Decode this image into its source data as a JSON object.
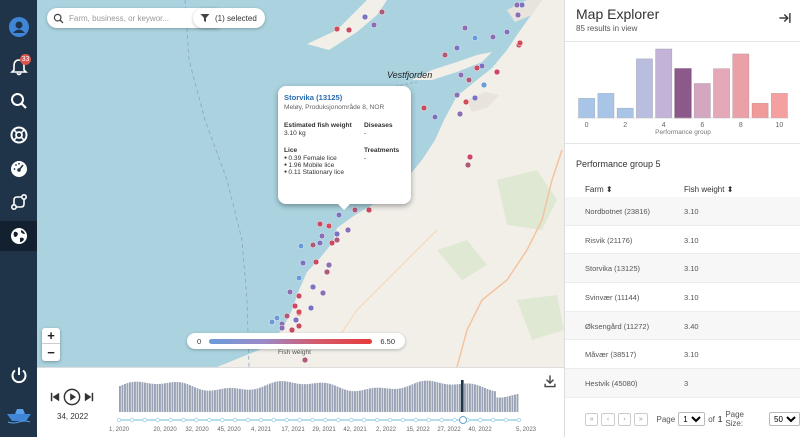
{
  "sidebar": {
    "items": [
      {
        "name": "user",
        "icon": "user-icon"
      },
      {
        "name": "notifications",
        "icon": "bell-icon",
        "badge": "33"
      },
      {
        "name": "search",
        "icon": "search-icon"
      },
      {
        "name": "help",
        "icon": "lifebuoy-icon"
      },
      {
        "name": "dashboard",
        "icon": "gauge-icon"
      },
      {
        "name": "routes",
        "icon": "route-icon"
      },
      {
        "name": "map",
        "icon": "globe-icon",
        "active": true
      },
      {
        "name": "power",
        "icon": "power-icon"
      },
      {
        "name": "logo",
        "icon": "boat-logo-icon"
      }
    ]
  },
  "map": {
    "search_placeholder": "Farm, business, or keywor...",
    "filter_label": "(1) selected",
    "place_label": "Vestfjorden",
    "popup": {
      "title": "Storvika (13125)",
      "subtitle": "Meløy, Produksjonområde 8, NOR",
      "weight_label": "Estimated fish weight",
      "weight_value": "3.10 kg",
      "diseases_label": "Diseases",
      "diseases_value": "-",
      "lice_label": "Lice",
      "lice_items": [
        "0.39 Female lice",
        "1.96 Mobile lice",
        "0.11 Stationary lice"
      ],
      "treatments_label": "Treatments",
      "treatments_value": "-"
    },
    "zoom_in": "+",
    "zoom_out": "−",
    "legend_min": "0",
    "legend_max": "6.50",
    "legend_label": "Fish weight",
    "colors": {
      "water": "#aad3df",
      "land": "#f2efe9",
      "low": "#6b9bd8",
      "high": "#e53b3b"
    }
  },
  "timeline": {
    "current_label": "34, 2022",
    "ticks": [
      "1, 2020",
      "20, 2020",
      "32, 2020",
      "45, 2020",
      "4, 2021",
      "17, 2021",
      "29, 2021",
      "42, 2021",
      "2, 2022",
      "15, 2022",
      "27, 2022",
      "40, 2022",
      "5, 2023"
    ]
  },
  "panel": {
    "title": "Map Explorer",
    "subtitle": "85 results in view",
    "histogram_xlabel": "Performance group",
    "histogram_ticks": [
      "0",
      "2",
      "4",
      "6",
      "8",
      "10"
    ],
    "group_title": "Performance group 5",
    "col_farm": "Farm",
    "col_weight": "Fish weight",
    "rows": [
      {
        "farm": "Nordbotnet (23816)",
        "weight": "3.10"
      },
      {
        "farm": "Risvik (21176)",
        "weight": "3.10"
      },
      {
        "farm": "Storvika (13125)",
        "weight": "3.10"
      },
      {
        "farm": "Svinvær (11144)",
        "weight": "3.10"
      },
      {
        "farm": "Øksengård (11272)",
        "weight": "3.40"
      },
      {
        "farm": "Måvær (38517)",
        "weight": "3.10"
      },
      {
        "farm": "Hestvik (45080)",
        "weight": "3"
      }
    ],
    "pager": {
      "page_label": "Page",
      "page_value": "1",
      "of_label": "of",
      "total_pages": "1",
      "size_label": "Page Size:",
      "size_value": "50"
    }
  },
  "chart_data": {
    "type": "bar",
    "categories": [
      "0",
      "1",
      "2",
      "3",
      "4",
      "5",
      "6",
      "7",
      "8",
      "9",
      "10"
    ],
    "values": [
      20,
      25,
      10,
      60,
      70,
      50,
      35,
      50,
      65,
      15,
      25
    ],
    "xlabel": "Performance group",
    "ylabel": "",
    "ylim": [
      0,
      75
    ],
    "selected": 5,
    "colors": [
      "#a8c5e8",
      "#a8c5e8",
      "#a8c5e8",
      "#b9bde0",
      "#c3b3d8",
      "#8b5a8a",
      "#d5a6c0",
      "#e5a8b8",
      "#eba0a8",
      "#f09a9a",
      "#f5a0a0"
    ]
  }
}
